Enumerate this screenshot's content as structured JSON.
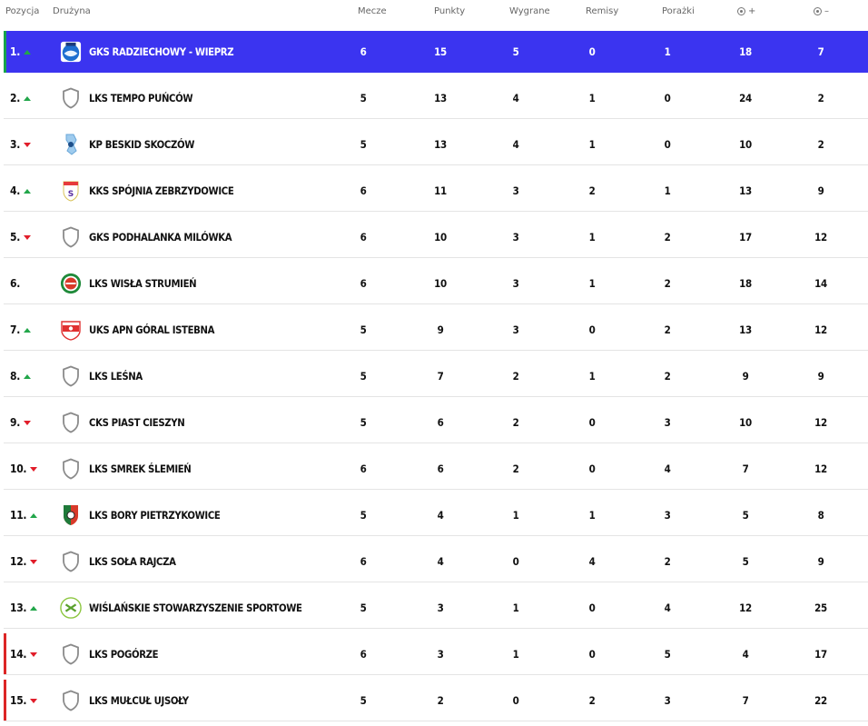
{
  "header": {
    "position": "Pozycja",
    "team": "Drużyna",
    "matches": "Mecze",
    "points": "Punkty",
    "wins": "Wygrane",
    "draws": "Remisy",
    "losses": "Porażki",
    "goals_for": "+",
    "goals_against": "–"
  },
  "colors": {
    "leader": "#3b34f0",
    "promotion": "#16a34a",
    "relegation": "#dc2626",
    "up": "#22a64a",
    "down": "#e11d2a"
  },
  "rows": [
    {
      "pos": "1.",
      "trend": "up",
      "logo": "radziechowy-crest",
      "team": "GKS Radziechowy - Wieprz",
      "m": "6",
      "p": "15",
      "w": "5",
      "d": "0",
      "l": "1",
      "gf": "18",
      "ga": "7",
      "zone": "leader"
    },
    {
      "pos": "2.",
      "trend": "up",
      "logo": "shield-placeholder-icon",
      "team": "LKS Tempo Puńców",
      "m": "5",
      "p": "13",
      "w": "4",
      "d": "1",
      "l": "0",
      "gf": "24",
      "ga": "2",
      "zone": ""
    },
    {
      "pos": "3.",
      "trend": "down",
      "logo": "beskid-crest",
      "team": "KP Beskid Skoczów",
      "m": "5",
      "p": "13",
      "w": "4",
      "d": "1",
      "l": "0",
      "gf": "10",
      "ga": "2",
      "zone": ""
    },
    {
      "pos": "4.",
      "trend": "up",
      "logo": "spojnia-crest",
      "team": "KKS Spójnia Zebrzydowice",
      "m": "6",
      "p": "11",
      "w": "3",
      "d": "2",
      "l": "1",
      "gf": "13",
      "ga": "9",
      "zone": ""
    },
    {
      "pos": "5.",
      "trend": "down",
      "logo": "shield-placeholder-icon",
      "team": "GKS Podhalanka Milówka",
      "m": "6",
      "p": "10",
      "w": "3",
      "d": "1",
      "l": "2",
      "gf": "17",
      "ga": "12",
      "zone": ""
    },
    {
      "pos": "6.",
      "trend": "none",
      "logo": "wisla-crest",
      "team": "LKS Wisła Strumień",
      "m": "6",
      "p": "10",
      "w": "3",
      "d": "1",
      "l": "2",
      "gf": "18",
      "ga": "14",
      "zone": ""
    },
    {
      "pos": "7.",
      "trend": "up",
      "logo": "goral-crest",
      "team": "UKS APN Góral Istebna",
      "m": "5",
      "p": "9",
      "w": "3",
      "d": "0",
      "l": "2",
      "gf": "13",
      "ga": "12",
      "zone": ""
    },
    {
      "pos": "8.",
      "trend": "up",
      "logo": "shield-placeholder-icon",
      "team": "LKS Leśna",
      "m": "5",
      "p": "7",
      "w": "2",
      "d": "1",
      "l": "2",
      "gf": "9",
      "ga": "9",
      "zone": ""
    },
    {
      "pos": "9.",
      "trend": "down",
      "logo": "shield-placeholder-icon",
      "team": "CKS Piast Cieszyn",
      "m": "5",
      "p": "6",
      "w": "2",
      "d": "0",
      "l": "3",
      "gf": "10",
      "ga": "12",
      "zone": ""
    },
    {
      "pos": "10.",
      "trend": "down",
      "logo": "shield-placeholder-icon",
      "team": "LKS Smrek Ślemień",
      "m": "6",
      "p": "6",
      "w": "2",
      "d": "0",
      "l": "4",
      "gf": "7",
      "ga": "12",
      "zone": ""
    },
    {
      "pos": "11.",
      "trend": "up",
      "logo": "bory-crest",
      "team": "LKS Bory Pietrzykowice",
      "m": "5",
      "p": "4",
      "w": "1",
      "d": "1",
      "l": "3",
      "gf": "5",
      "ga": "8",
      "zone": ""
    },
    {
      "pos": "12.",
      "trend": "down",
      "logo": "shield-placeholder-icon",
      "team": "LKS Soła Rajcza",
      "m": "6",
      "p": "4",
      "w": "0",
      "d": "4",
      "l": "2",
      "gf": "5",
      "ga": "9",
      "zone": ""
    },
    {
      "pos": "13.",
      "trend": "up",
      "logo": "wss-crest",
      "team": "Wiślańskie Stowarzyszenie Sportowe",
      "m": "5",
      "p": "3",
      "w": "1",
      "d": "0",
      "l": "4",
      "gf": "12",
      "ga": "25",
      "zone": ""
    },
    {
      "pos": "14.",
      "trend": "down",
      "logo": "shield-placeholder-icon",
      "team": "LKS Pogórze",
      "m": "6",
      "p": "3",
      "w": "1",
      "d": "0",
      "l": "5",
      "gf": "4",
      "ga": "17",
      "zone": "releg"
    },
    {
      "pos": "15.",
      "trend": "down",
      "logo": "shield-placeholder-icon",
      "team": "LKS Mułcuł Ujsoły",
      "m": "5",
      "p": "2",
      "w": "0",
      "d": "2",
      "l": "3",
      "gf": "7",
      "ga": "22",
      "zone": "releg"
    }
  ]
}
